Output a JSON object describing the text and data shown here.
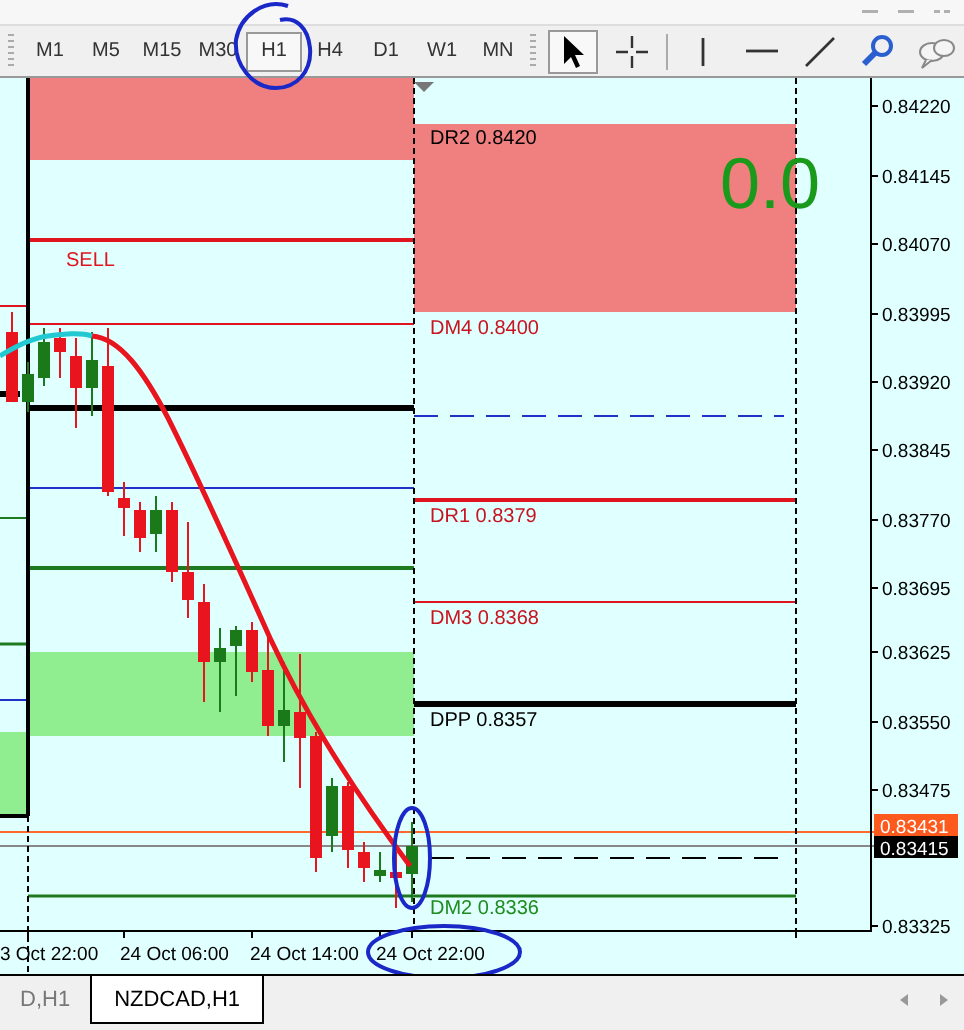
{
  "toolbar": {
    "timeframes": [
      {
        "label": "M1",
        "selected": false
      },
      {
        "label": "M5",
        "selected": false
      },
      {
        "label": "M15",
        "selected": false
      },
      {
        "label": "M30",
        "selected": false
      },
      {
        "label": "H1",
        "selected": true
      },
      {
        "label": "H4",
        "selected": false
      },
      {
        "label": "D1",
        "selected": false
      },
      {
        "label": "W1",
        "selected": false
      },
      {
        "label": "MN",
        "selected": false
      }
    ],
    "tools": [
      {
        "kind": "cursor",
        "selected": true
      },
      {
        "kind": "crosshair",
        "selected": false
      },
      {
        "kind": "separator"
      },
      {
        "kind": "vline",
        "selected": false
      },
      {
        "kind": "hline",
        "selected": false
      },
      {
        "kind": "trendline",
        "selected": false
      },
      {
        "kind": "zoom",
        "selected": false
      },
      {
        "kind": "chat",
        "selected": false
      }
    ]
  },
  "chart": {
    "price_labels": [
      "0.84220",
      "0.84145",
      "0.84070",
      "0.83995",
      "0.83920",
      "0.83845",
      "0.83770",
      "0.83695",
      "0.83625",
      "0.83550",
      "0.83475",
      "0.83325"
    ],
    "current_prices": [
      {
        "value": "0.83431",
        "color": "#ff5a1e"
      },
      {
        "value": "0.83415",
        "color": "#000000"
      }
    ],
    "time_labels": [
      "3 Oct 22:00",
      "24 Oct 06:00",
      "24 Oct 14:00",
      "24 Oct 22:00"
    ],
    "levels": [
      {
        "label": "DR2 0.8420",
        "color": "#000000"
      },
      {
        "label": "DM4 0.8400",
        "color": "#c8141e"
      },
      {
        "label": "DR1 0.8379",
        "color": "#c8141e"
      },
      {
        "label": "DM3 0.8368",
        "color": "#c8141e"
      },
      {
        "label": "DPP 0.8357",
        "color": "#000000"
      },
      {
        "label": "DM2 0.8336",
        "color": "#1e8c1e"
      }
    ],
    "signal_label": "SELL",
    "counter": "0.0"
  },
  "tabs": [
    {
      "label": "D,H1",
      "selected": false
    },
    {
      "label": "NZDCAD,H1",
      "selected": true
    }
  ]
}
